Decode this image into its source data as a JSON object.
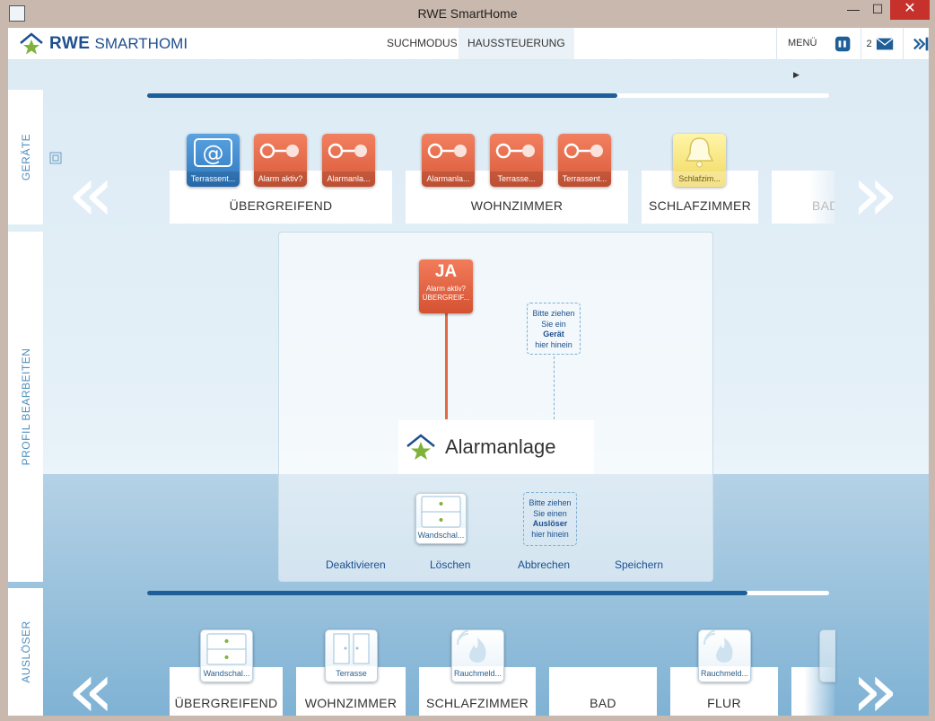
{
  "window": {
    "title": "RWE SmartHome",
    "minimize": "—",
    "maximize": "☐",
    "close": "✕"
  },
  "header": {
    "logo_rwe": "RWE",
    "logo_smarthome": "SMARTHOMI",
    "nav": [
      {
        "label": "SUCHMODUS"
      },
      {
        "label": "HAUSSTEUERUNG"
      }
    ],
    "menu_label": "MENÜ",
    "message_count": "2"
  },
  "sidebar": {
    "geraete": "GERÄTE",
    "profil": "PROFIL BEARBEITEN",
    "ausloeser": "AUSLÖSER"
  },
  "geraete": {
    "progress": 0.69,
    "rooms": [
      {
        "label": "ÜBERGREIFEND",
        "tiles": [
          "Terrassent...",
          "Alarm aktiv?",
          "Alarmanla..."
        ]
      },
      {
        "label": "WOHNZIMMER",
        "tiles": [
          "Alarmanla...",
          "Terrasse...",
          "Terrassent..."
        ]
      },
      {
        "label": "SCHLAFZIMMER",
        "tiles": [
          "Schlafzim..."
        ]
      },
      {
        "label": "BAD",
        "tiles": []
      }
    ]
  },
  "editor": {
    "condition": {
      "value": "JA",
      "line1": "Alarm aktiv?",
      "line2": "ÜBERGREIF..."
    },
    "drop_device": {
      "l1": "Bitte ziehen",
      "l2": "Sie ein",
      "l3": "Gerät",
      "l4": "hier hinein"
    },
    "profile_name": "Alarmanlage",
    "trigger_tile": "Wandschal...",
    "drop_trigger": {
      "l1": "Bitte ziehen",
      "l2": "Sie einen",
      "l3": "Auslöser",
      "l4": "hier hinein"
    },
    "actions": {
      "deactivate": "Deaktivieren",
      "delete": "Löschen",
      "cancel": "Abbrechen",
      "save": "Speichern"
    }
  },
  "ausloeser": {
    "progress": 0.88,
    "rooms": [
      {
        "label": "ÜBERGREIFEND",
        "tile": "Wandschal..."
      },
      {
        "label": "WOHNZIMMER",
        "tile": "Terrasse"
      },
      {
        "label": "SCHLAFZIMMER",
        "tile": "Rauchmeld..."
      },
      {
        "label": "BAD",
        "tile": ""
      },
      {
        "label": "FLUR",
        "tile": "Rauchmeld..."
      }
    ]
  },
  "colors": {
    "brand_blue": "#1e4f8f",
    "accent_orange": "#d85a3a",
    "logo_green": "#7fb23a"
  }
}
